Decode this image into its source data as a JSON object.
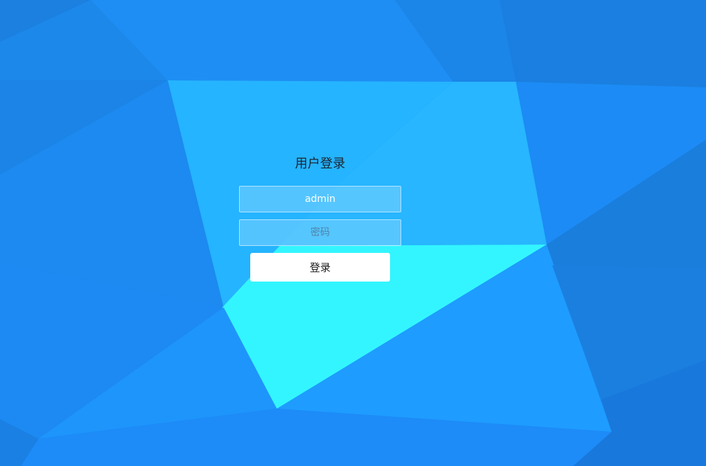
{
  "login": {
    "title": "用户登录",
    "username_value": "admin",
    "password_placeholder": "密码",
    "submit_label": "登录"
  },
  "colors": {
    "background_base": "#1a86e8",
    "highlight_light": "#24b4ff",
    "highlight_cyan": "#33f5ff",
    "button_bg": "#ffffff"
  }
}
